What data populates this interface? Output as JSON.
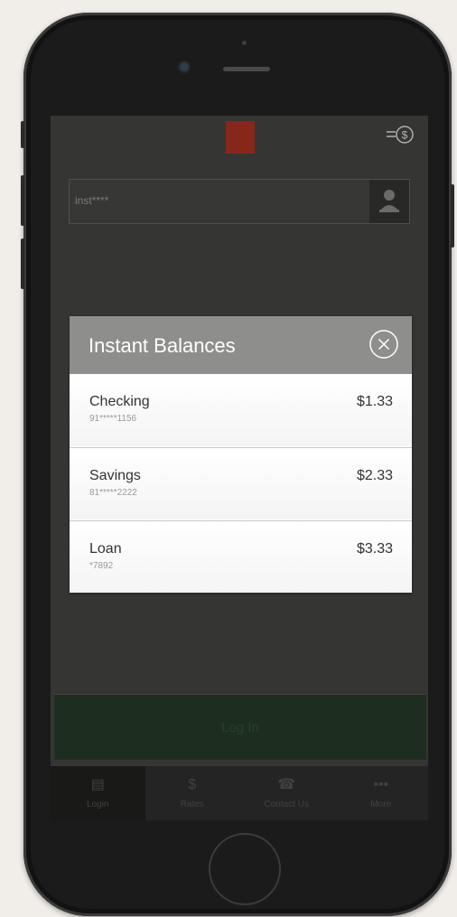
{
  "app": {
    "login_username": "inst****",
    "login_button_label": "Log In"
  },
  "tabs": [
    {
      "label": "Login",
      "icon": "login-icon"
    },
    {
      "label": "Rates",
      "icon": "dollar-icon"
    },
    {
      "label": "Contact Us",
      "icon": "phone-icon"
    },
    {
      "label": "More",
      "icon": "more-icon"
    }
  ],
  "modal": {
    "title": "Instant Balances",
    "accounts": [
      {
        "name": "Checking",
        "number": "91*****1156",
        "balance": "$1.33"
      },
      {
        "name": "Savings",
        "number": "81*****2222",
        "balance": "$2.33"
      },
      {
        "name": "Loan",
        "number": "*7892",
        "balance": "$3.33"
      }
    ]
  },
  "colors": {
    "brand_logo": "#9a2d1d",
    "screen_bg": "#3d3e3c",
    "modal_header": "#8e8f8d",
    "login_button": "#223526"
  }
}
